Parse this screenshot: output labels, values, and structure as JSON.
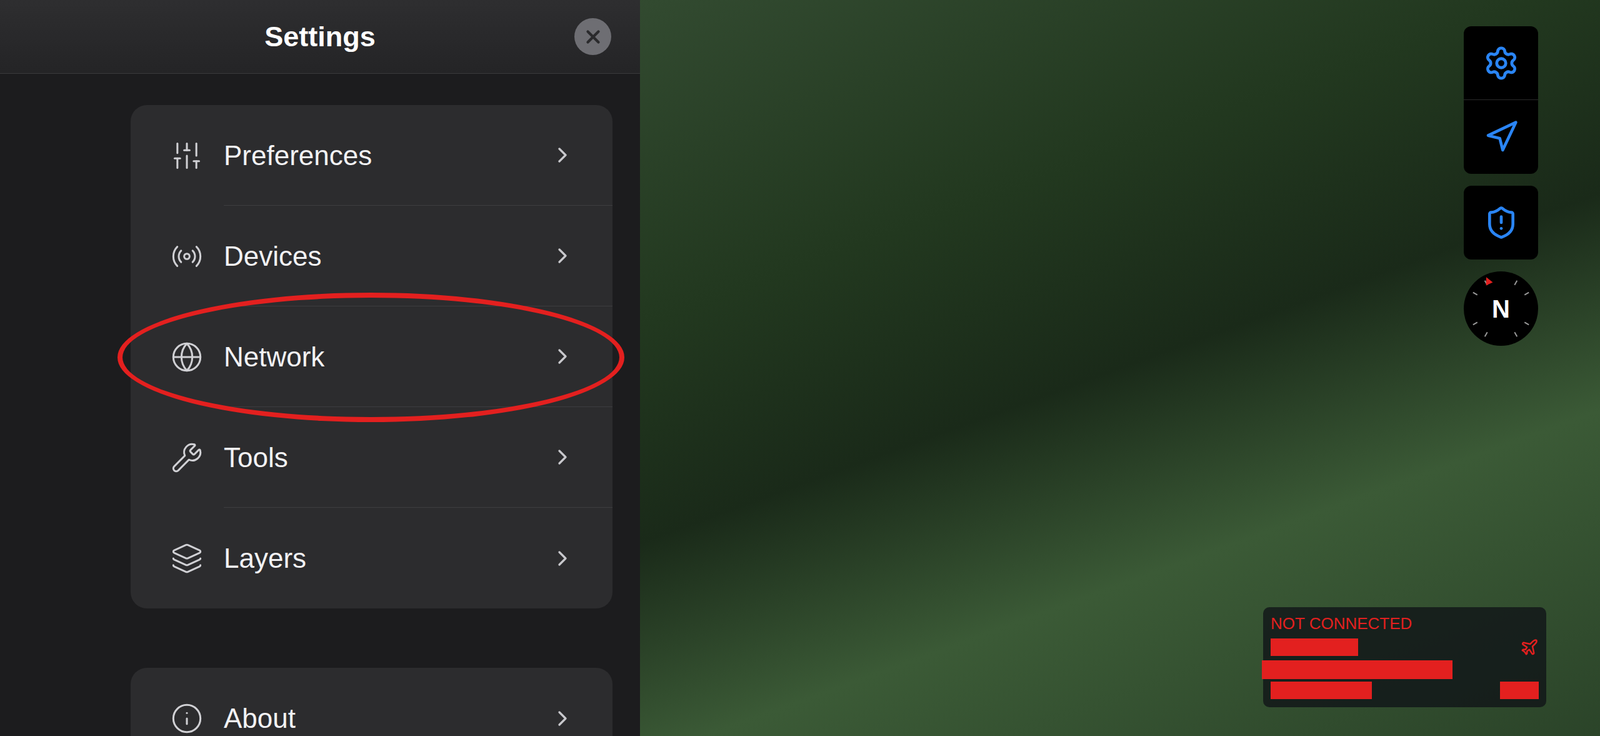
{
  "settings_panel": {
    "title": "Settings",
    "close_button": {
      "label": ""
    }
  },
  "menu": {
    "items": [
      {
        "label": "Preferences",
        "circled": false
      },
      {
        "label": "Devices",
        "circled": false
      },
      {
        "label": "Network",
        "circled": true
      },
      {
        "label": "Tools",
        "circled": false
      },
      {
        "label": "Layers",
        "circled": false
      }
    ]
  },
  "secondary_menu": {
    "items": [
      {
        "label": "About",
        "circled": false
      }
    ]
  },
  "map_controls": {
    "compass": "N"
  },
  "status_box": {
    "title": "NOT CONNECTED",
    "connected": false
  }
}
